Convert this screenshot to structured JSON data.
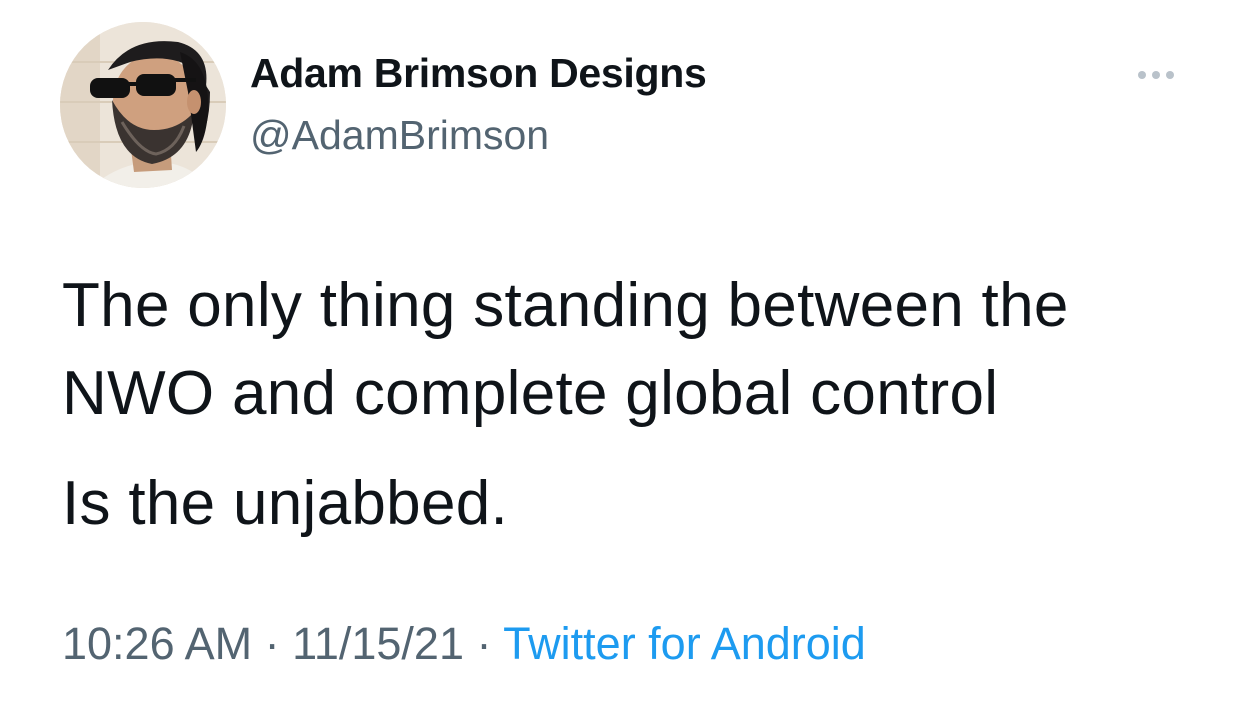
{
  "author": {
    "display_name": "Adam Brimson Designs",
    "handle": "@AdamBrimson"
  },
  "tweet": {
    "line1": "The only thing standing between the",
    "line2": "NWO and complete global control",
    "line3": "Is the unjabbed."
  },
  "meta": {
    "time": "10:26 AM",
    "separator": " · ",
    "date": "11/15/21",
    "source": "Twitter for Android"
  },
  "icons": {
    "more": "more-horizontal-icon"
  },
  "colors": {
    "text_primary": "#0f1419",
    "text_secondary": "#536471",
    "link": "#1d9bf0",
    "dots": "#b9c2ca"
  }
}
